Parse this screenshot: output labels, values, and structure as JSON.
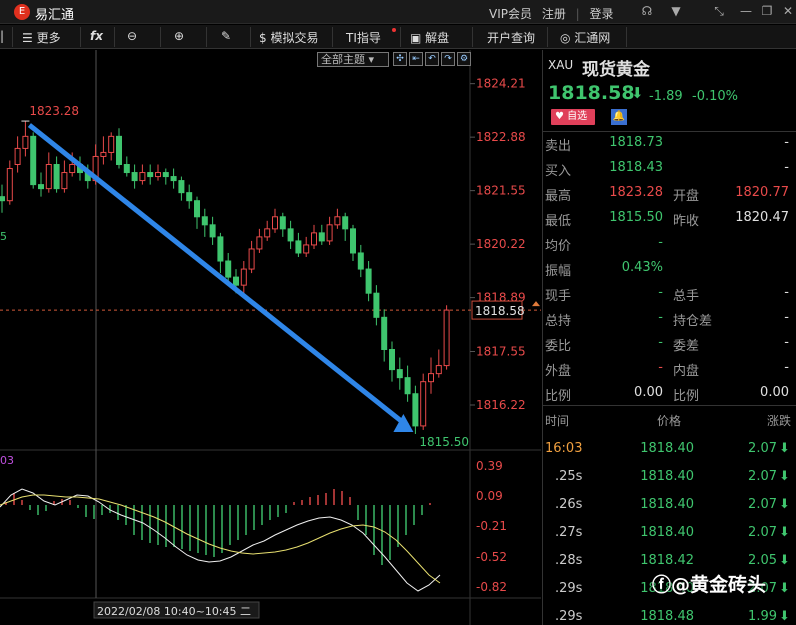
{
  "app": {
    "name": "易汇通",
    "logo": "E"
  },
  "title_links": [
    "VIP会员",
    "注册",
    "登录"
  ],
  "window_icons": [
    "headset-icon",
    "shirt-icon",
    "shrink-icon",
    "restore-icon",
    "close-icon"
  ],
  "toolbar": {
    "more": "更多",
    "fx": "fx",
    "sim": "模拟交易",
    "ti": "TI指导",
    "jiepan": "解盘",
    "account": "开户查询",
    "huitong": "汇通网"
  },
  "chart": {
    "topic": "全部主题",
    "last_price_tag": "1818.58",
    "high_label": "1823.28",
    "low_label": "1815.50",
    "crosshair_time": "2022/02/08 10:40~10:45 二",
    "left_label": "5",
    "macd_label": "03",
    "price_axis": [
      "1824.21",
      "1822.88",
      "1821.55",
      "1820.22",
      "1818.89",
      "1817.55",
      "1816.22"
    ],
    "macd_axis": [
      "0.39",
      "0.09",
      "-0.21",
      "-0.52",
      "-0.82"
    ]
  },
  "chart_data": {
    "type": "candlestick",
    "price_ylim": [
      1815.3,
      1824.5
    ],
    "macd_ylim": [
      -0.9,
      0.45
    ],
    "high": 1823.28,
    "low": 1815.5,
    "last": 1818.58,
    "candles": [
      [
        1821.4,
        1821.3,
        1821.7,
        1821.0
      ],
      [
        1821.3,
        1822.1,
        1822.3,
        1821.2
      ],
      [
        1822.2,
        1822.6,
        1822.9,
        1822.0
      ],
      [
        1822.6,
        1822.9,
        1823.28,
        1822.4
      ],
      [
        1822.9,
        1821.7,
        1823.0,
        1821.6
      ],
      [
        1821.7,
        1821.6,
        1822.0,
        1821.4
      ],
      [
        1821.6,
        1822.2,
        1822.5,
        1821.5
      ],
      [
        1822.2,
        1821.6,
        1822.4,
        1821.5
      ],
      [
        1821.6,
        1822.0,
        1822.3,
        1821.5
      ],
      [
        1822.0,
        1822.2,
        1822.5,
        1821.9
      ],
      [
        1822.2,
        1822.0,
        1822.4,
        1821.8
      ],
      [
        1822.0,
        1821.8,
        1822.2,
        1821.6
      ],
      [
        1821.8,
        1822.4,
        1822.7,
        1821.7
      ],
      [
        1822.4,
        1822.5,
        1822.9,
        1822.2
      ],
      [
        1822.5,
        1822.9,
        1823.0,
        1822.3
      ],
      [
        1822.9,
        1822.2,
        1823.1,
        1822.1
      ],
      [
        1822.2,
        1822.0,
        1822.4,
        1821.9
      ],
      [
        1822.0,
        1821.8,
        1822.2,
        1821.6
      ],
      [
        1821.8,
        1822.0,
        1822.2,
        1821.7
      ],
      [
        1822.0,
        1821.9,
        1822.2,
        1821.7
      ],
      [
        1821.9,
        1822.0,
        1822.2,
        1821.8
      ],
      [
        1822.0,
        1821.9,
        1822.1,
        1821.7
      ],
      [
        1821.9,
        1821.8,
        1822.1,
        1821.6
      ],
      [
        1821.8,
        1821.5,
        1821.9,
        1821.3
      ],
      [
        1821.5,
        1821.3,
        1821.7,
        1821.1
      ],
      [
        1821.3,
        1820.9,
        1821.4,
        1820.6
      ],
      [
        1820.9,
        1820.7,
        1821.1,
        1820.4
      ],
      [
        1820.7,
        1820.4,
        1820.9,
        1820.2
      ],
      [
        1820.4,
        1819.8,
        1820.5,
        1819.5
      ],
      [
        1819.8,
        1819.4,
        1820.0,
        1819.2
      ],
      [
        1819.4,
        1819.2,
        1819.6,
        1819.0
      ],
      [
        1819.2,
        1819.6,
        1819.8,
        1819.0
      ],
      [
        1819.6,
        1820.1,
        1820.3,
        1819.5
      ],
      [
        1820.1,
        1820.4,
        1820.6,
        1820.0
      ],
      [
        1820.4,
        1820.6,
        1820.8,
        1820.3
      ],
      [
        1820.6,
        1820.9,
        1821.1,
        1820.5
      ],
      [
        1820.9,
        1820.6,
        1821.0,
        1820.4
      ],
      [
        1820.6,
        1820.3,
        1820.8,
        1820.1
      ],
      [
        1820.3,
        1820.0,
        1820.5,
        1819.9
      ],
      [
        1820.0,
        1820.2,
        1820.4,
        1819.9
      ],
      [
        1820.2,
        1820.5,
        1820.7,
        1820.1
      ],
      [
        1820.5,
        1820.3,
        1820.7,
        1820.2
      ],
      [
        1820.3,
        1820.7,
        1820.9,
        1820.2
      ],
      [
        1820.7,
        1820.9,
        1821.1,
        1820.6
      ],
      [
        1820.9,
        1820.6,
        1821.0,
        1820.3
      ],
      [
        1820.6,
        1820.0,
        1820.7,
        1819.8
      ],
      [
        1820.0,
        1819.6,
        1820.2,
        1819.4
      ],
      [
        1819.6,
        1819.0,
        1819.8,
        1818.8
      ],
      [
        1819.0,
        1818.4,
        1819.2,
        1818.2
      ],
      [
        1818.4,
        1817.6,
        1818.6,
        1817.3
      ],
      [
        1817.6,
        1817.1,
        1817.8,
        1816.8
      ],
      [
        1817.1,
        1816.9,
        1817.4,
        1816.6
      ],
      [
        1816.9,
        1816.5,
        1817.2,
        1816.3
      ],
      [
        1816.5,
        1815.7,
        1816.7,
        1815.5
      ],
      [
        1815.7,
        1816.8,
        1817.0,
        1815.6
      ],
      [
        1816.8,
        1817.0,
        1817.4,
        1816.5
      ],
      [
        1817.0,
        1817.2,
        1817.6,
        1816.9
      ],
      [
        1817.2,
        1818.58,
        1818.7,
        1817.1
      ]
    ],
    "macd_hist": [
      0.03,
      0.12,
      0.05,
      -0.05,
      -0.1,
      -0.06,
      0.04,
      0.06,
      0.05,
      -0.03,
      -0.12,
      -0.14,
      -0.1,
      -0.08,
      -0.15,
      -0.2,
      -0.3,
      -0.35,
      -0.38,
      -0.4,
      -0.42,
      -0.42,
      -0.44,
      -0.46,
      -0.48,
      -0.5,
      -0.52,
      -0.48,
      -0.4,
      -0.35,
      -0.3,
      -0.25,
      -0.2,
      -0.15,
      -0.12,
      -0.08,
      0.03,
      0.05,
      0.08,
      0.1,
      0.12,
      0.16,
      0.14,
      0.08,
      -0.15,
      -0.3,
      -0.5,
      -0.6,
      -0.55,
      -0.42,
      -0.3,
      -0.2,
      -0.1,
      0.02
    ],
    "macd_dif": [
      -0.02,
      0.1,
      0.16,
      0.12,
      0.04,
      0.0,
      0.05,
      0.1,
      0.09,
      0.03,
      -0.05,
      -0.1,
      -0.14,
      -0.18,
      -0.25,
      -0.33,
      -0.42,
      -0.5,
      -0.55,
      -0.57,
      -0.56,
      -0.52,
      -0.46,
      -0.4,
      -0.36,
      -0.3,
      -0.25,
      -0.2,
      -0.16,
      -0.13,
      -0.12,
      -0.15,
      -0.2,
      -0.28,
      -0.4,
      -0.52,
      -0.65,
      -0.78,
      -0.86,
      -0.8,
      -0.7
    ],
    "macd_dea": [
      0.0,
      0.04,
      0.08,
      0.1,
      0.1,
      0.09,
      0.08,
      0.08,
      0.07,
      0.06,
      0.03,
      0.0,
      -0.04,
      -0.08,
      -0.12,
      -0.17,
      -0.23,
      -0.29,
      -0.34,
      -0.39,
      -0.43,
      -0.46,
      -0.48,
      -0.49,
      -0.48,
      -0.47,
      -0.45,
      -0.42,
      -0.38,
      -0.33,
      -0.28,
      -0.24,
      -0.21,
      -0.2,
      -0.22,
      -0.27,
      -0.35,
      -0.46,
      -0.58,
      -0.7,
      -0.78
    ]
  },
  "quote": {
    "symbol": "XAU",
    "name": "现货黄金",
    "price": "1818.58",
    "change": "-1.89",
    "change_pct": "-0.10%",
    "fav": "自选",
    "rows": [
      [
        "卖出",
        "1818.73",
        "",
        "-"
      ],
      [
        "买入",
        "1818.43",
        "",
        "-"
      ],
      [
        "最高",
        "1823.28",
        "开盘",
        "1820.77"
      ],
      [
        "最低",
        "1815.50",
        "昨收",
        "1820.47"
      ],
      [
        "均价",
        "-",
        "",
        ""
      ],
      [
        "振幅",
        "0.43%",
        "",
        ""
      ],
      [
        "现手",
        "-",
        "总手",
        "-"
      ],
      [
        "总持",
        "-",
        "持仓差",
        "-"
      ],
      [
        "委比",
        "-",
        "委差",
        "-"
      ],
      [
        "外盘",
        "-",
        "内盘",
        "-"
      ],
      [
        "比例",
        "0.00",
        "比例",
        "0.00"
      ]
    ]
  },
  "trades": {
    "headers": [
      "时间",
      "价格",
      "涨跌"
    ],
    "rows": [
      [
        "16:03",
        "1818.40",
        "2.07"
      ],
      [
        ".25s",
        "1818.40",
        "2.07"
      ],
      [
        ".26s",
        "1818.40",
        "2.07"
      ],
      [
        ".27s",
        "1818.40",
        "2.07"
      ],
      [
        ".28s",
        "1818.42",
        "2.05"
      ],
      [
        ".29s",
        "1818.40",
        "2.07"
      ],
      [
        ".29s",
        "1818.48",
        "1.99"
      ]
    ]
  },
  "watermark": "@黄金砖头"
}
